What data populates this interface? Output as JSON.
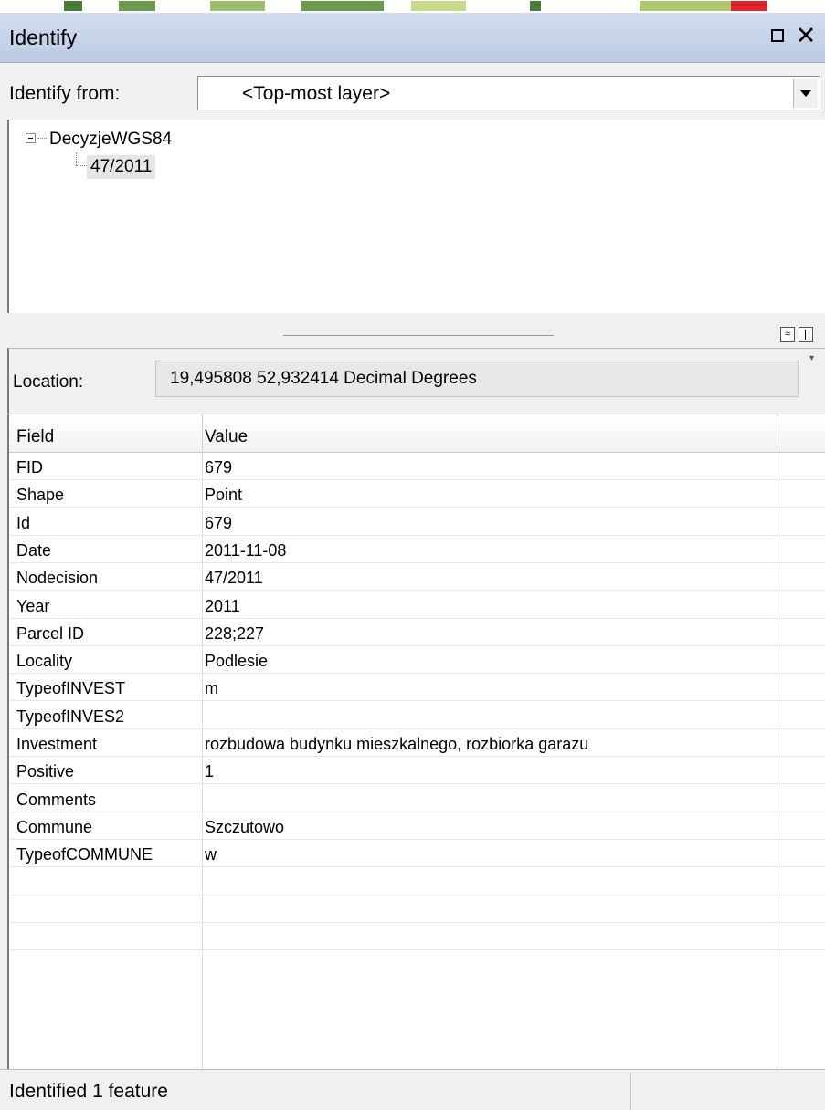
{
  "window": {
    "title": "Identify",
    "restore_icon": "restore-window-icon",
    "close_glyph": "✕"
  },
  "identify_from": {
    "label": "Identify from:",
    "selected": "<Top-most layer>"
  },
  "tree": {
    "root_label": "DecyzjeWGS84",
    "child_label": "47/2011"
  },
  "splitter": {
    "expand_glyph": "≈"
  },
  "location": {
    "label": "Location:",
    "value": "19,495808  52,932414 Decimal Degrees"
  },
  "table": {
    "headers": [
      "Field",
      "Value"
    ],
    "rows": [
      {
        "field": "FID",
        "value": "679"
      },
      {
        "field": "Shape",
        "value": "Point"
      },
      {
        "field": "Id",
        "value": "679"
      },
      {
        "field": "Date",
        "value": "2011-11-08"
      },
      {
        "field": "Nodecision",
        "value": "47/2011"
      },
      {
        "field": "Year",
        "value": "2011"
      },
      {
        "field": "Parcel ID",
        "value": "228;227"
      },
      {
        "field": "Locality",
        "value": "Podlesie"
      },
      {
        "field": "TypeofINVEST",
        "value": "m"
      },
      {
        "field": "TypeofINVES2",
        "value": ""
      },
      {
        "field": "Investment",
        "value": "rozbudowa budynku mieszkalnego, rozbiorka garazu"
      },
      {
        "field": "Positive",
        "value": "1"
      },
      {
        "field": "Comments",
        "value": ""
      },
      {
        "field": "Commune",
        "value": "Szczutowo"
      },
      {
        "field": "TypeofCOMMUNE",
        "value": "w"
      },
      {
        "field": "",
        "value": ""
      },
      {
        "field": "",
        "value": ""
      },
      {
        "field": "",
        "value": ""
      }
    ]
  },
  "status": {
    "text": "Identified 1 feature"
  }
}
